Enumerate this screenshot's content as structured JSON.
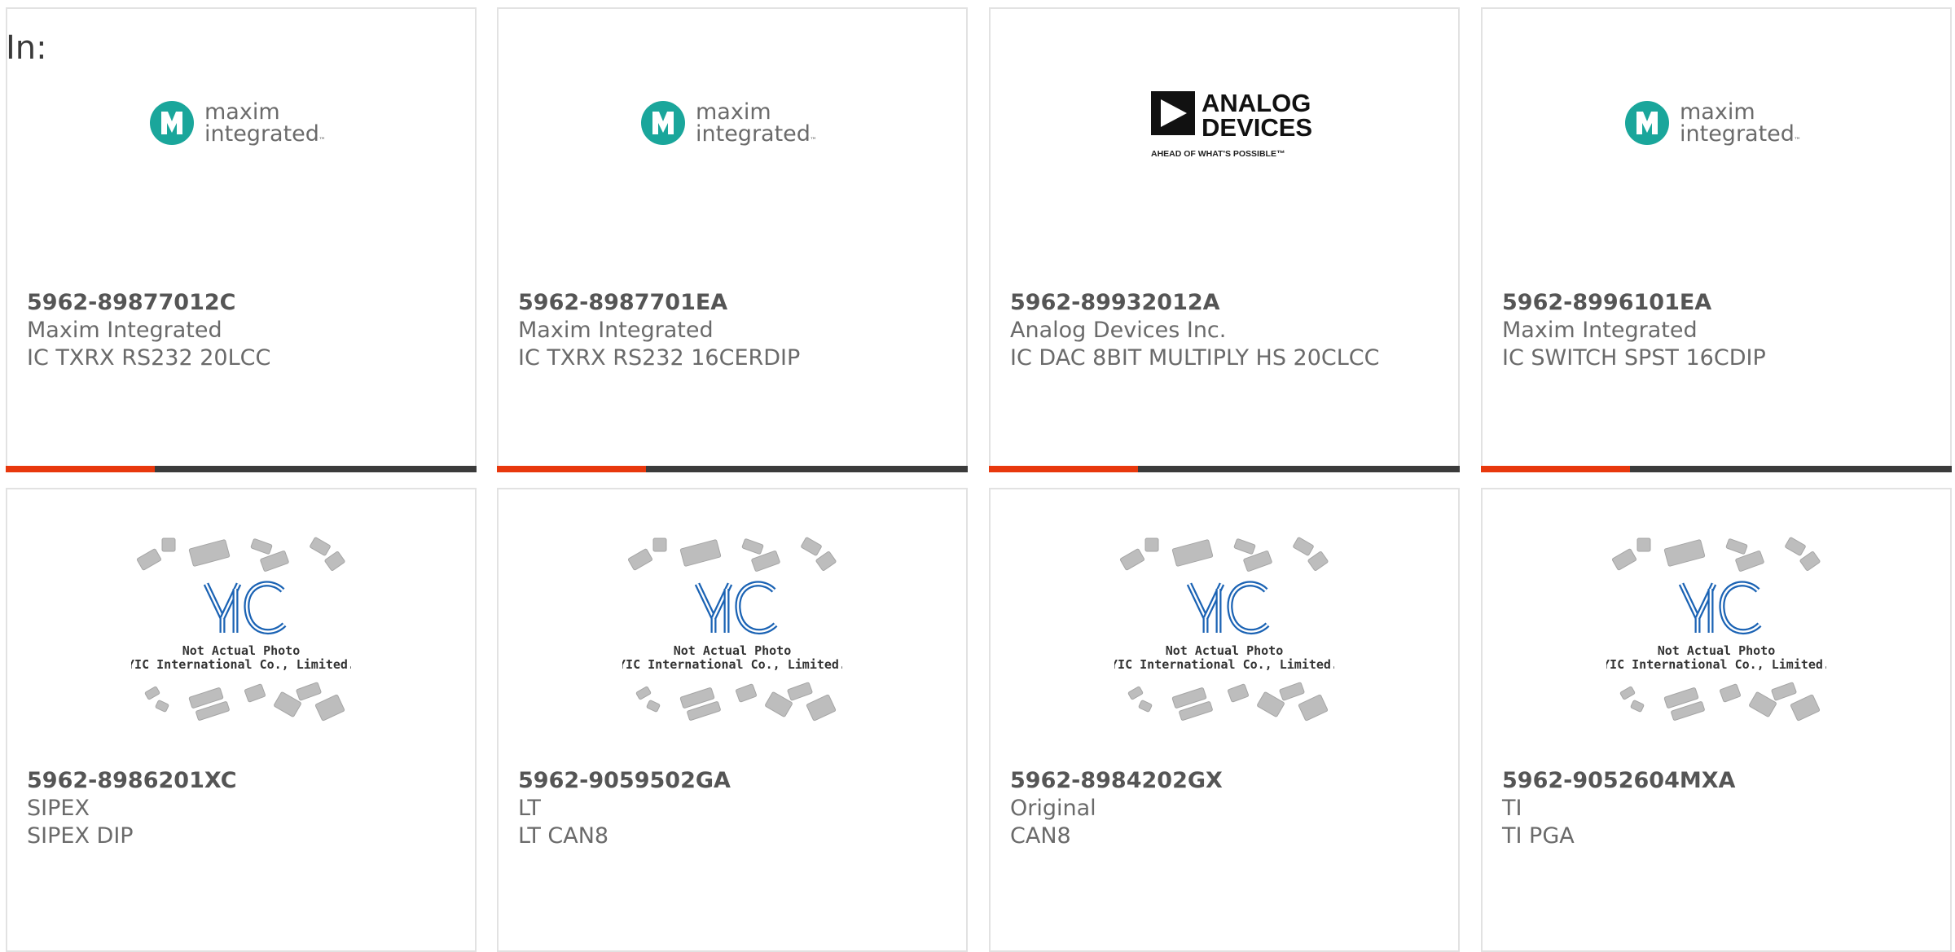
{
  "header": {
    "in_label": "In:"
  },
  "colors": {
    "accent": "#e8380d",
    "bar": "#3b3b3b",
    "maxim_teal": "#1aa69b",
    "yic_blue": "#1b63b4"
  },
  "placeholder": {
    "line1": "Not Actual Photo",
    "line2": "YIC International Co., Limited.",
    "logo_text": "YIC"
  },
  "logos": {
    "maxim": {
      "line1": "maxim",
      "line2": "integrated",
      "tm": "™"
    },
    "adi": {
      "line1": "ANALOG",
      "line2": "DEVICES",
      "tagline": "AHEAD OF WHAT'S POSSIBLE™"
    }
  },
  "products": [
    {
      "part": "5962-89877012C",
      "manufacturer": "Maxim Integrated",
      "description": "IC TXRX RS232 20LCC",
      "image": "maxim-logo"
    },
    {
      "part": "5962-8987701EA",
      "manufacturer": "Maxim Integrated",
      "description": "IC TXRX RS232 16CERDIP",
      "image": "maxim-logo"
    },
    {
      "part": "5962-89932012A",
      "manufacturer": "Analog Devices Inc.",
      "description": "IC DAC 8BIT MULTIPLY HS 20CLCC",
      "image": "adi-logo"
    },
    {
      "part": "5962-8996101EA",
      "manufacturer": "Maxim Integrated",
      "description": "IC SWITCH SPST 16CDIP",
      "image": "maxim-logo"
    },
    {
      "part": "5962-8986201XC",
      "manufacturer": "SIPEX",
      "description": "SIPEX DIP",
      "image": "not-actual-photo"
    },
    {
      "part": "5962-9059502GA",
      "manufacturer": "LT",
      "description": "LT CAN8",
      "image": "not-actual-photo"
    },
    {
      "part": "5962-8984202GX",
      "manufacturer": "Original",
      "description": "CAN8",
      "image": "not-actual-photo"
    },
    {
      "part": "5962-9052604MXA",
      "manufacturer": "TI",
      "description": "TI PGA",
      "image": "not-actual-photo"
    }
  ]
}
